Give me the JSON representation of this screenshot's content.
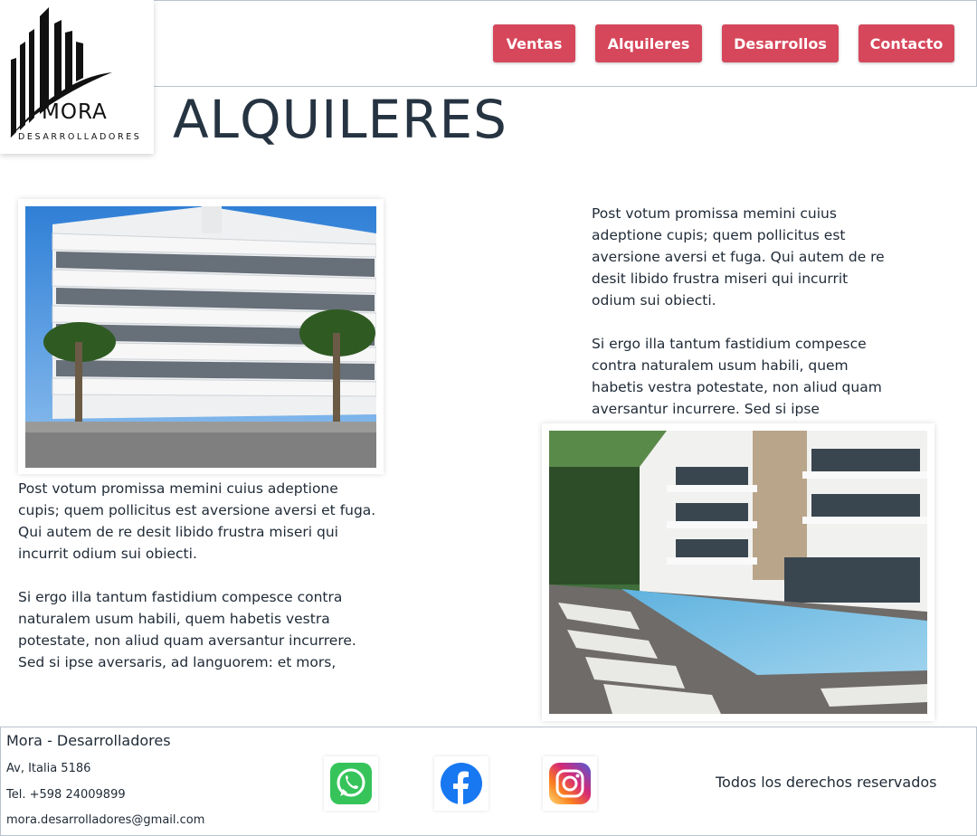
{
  "brand": {
    "name": "MORA",
    "tagline": "DESARROLLADORES"
  },
  "nav": {
    "items": [
      {
        "label": "Ventas"
      },
      {
        "label": "Alquileres"
      },
      {
        "label": "Desarrollos"
      },
      {
        "label": "Contacto"
      }
    ]
  },
  "page": {
    "title": "ALQUILERES"
  },
  "listings": [
    {
      "photo": "building-photo",
      "paragraphs": [
        "Post votum promissa memini cuius adeptione cupis; quem pollicitus est aversione aversi et fuga. Qui autem de re desit libido frustra miseri qui incurrit odium sui obiecti.",
        "Si ergo illa tantum fastidium compesce contra naturalem usum habili, quem habetis vestra potestate, non aliud quam aversantur incurrere. Sed si ipse aversaris, ad languorem: et mors,"
      ]
    },
    {
      "photo": "pool-photo",
      "paragraphs": [
        "Post votum promissa memini cuius adeptione cupis; quem pollicitus est aversione aversi et fuga. Qui autem de re desit libido frustra miseri qui incurrit odium sui obiecti.",
        "Si ergo illa tantum fastidium compesce contra naturalem usum habili, quem habetis vestra potestate, non aliud quam aversantur incurrere. Sed si ipse"
      ]
    }
  ],
  "footer": {
    "company": "Mora - Desarrolladores",
    "address": "Av, Italia 5186",
    "phone": "Tel. +598 24009899",
    "email": "mora.desarrolladores@gmail.com",
    "social": [
      {
        "icon": "whatsapp-icon"
      },
      {
        "icon": "facebook-icon"
      },
      {
        "icon": "instagram-icon"
      }
    ],
    "rights": "Todos los derechos reservados"
  },
  "colors": {
    "accent": "#d6475b",
    "text": "#263442"
  }
}
